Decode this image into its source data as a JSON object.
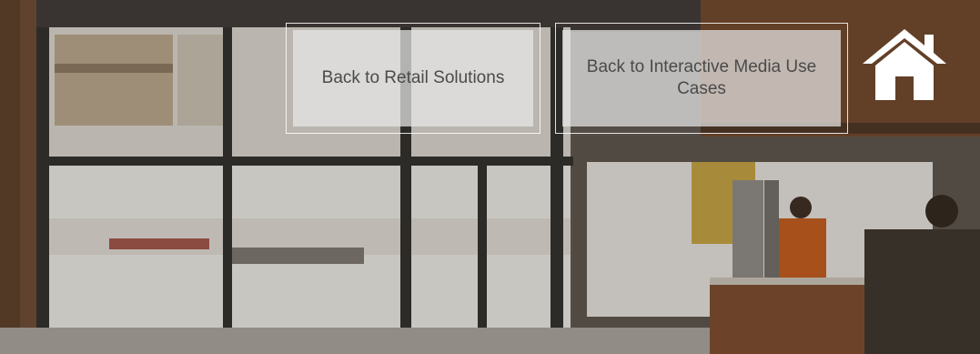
{
  "background": {
    "scene": "building-entrance-photo",
    "accent_wall": "#7a4a2a",
    "overlay": "#2a2522"
  },
  "nav": {
    "back_retail_label": "Back to Retail Solutions",
    "back_interactive_media_label": "Back to Interactive Media Use Cases",
    "home_icon": "home-icon"
  }
}
